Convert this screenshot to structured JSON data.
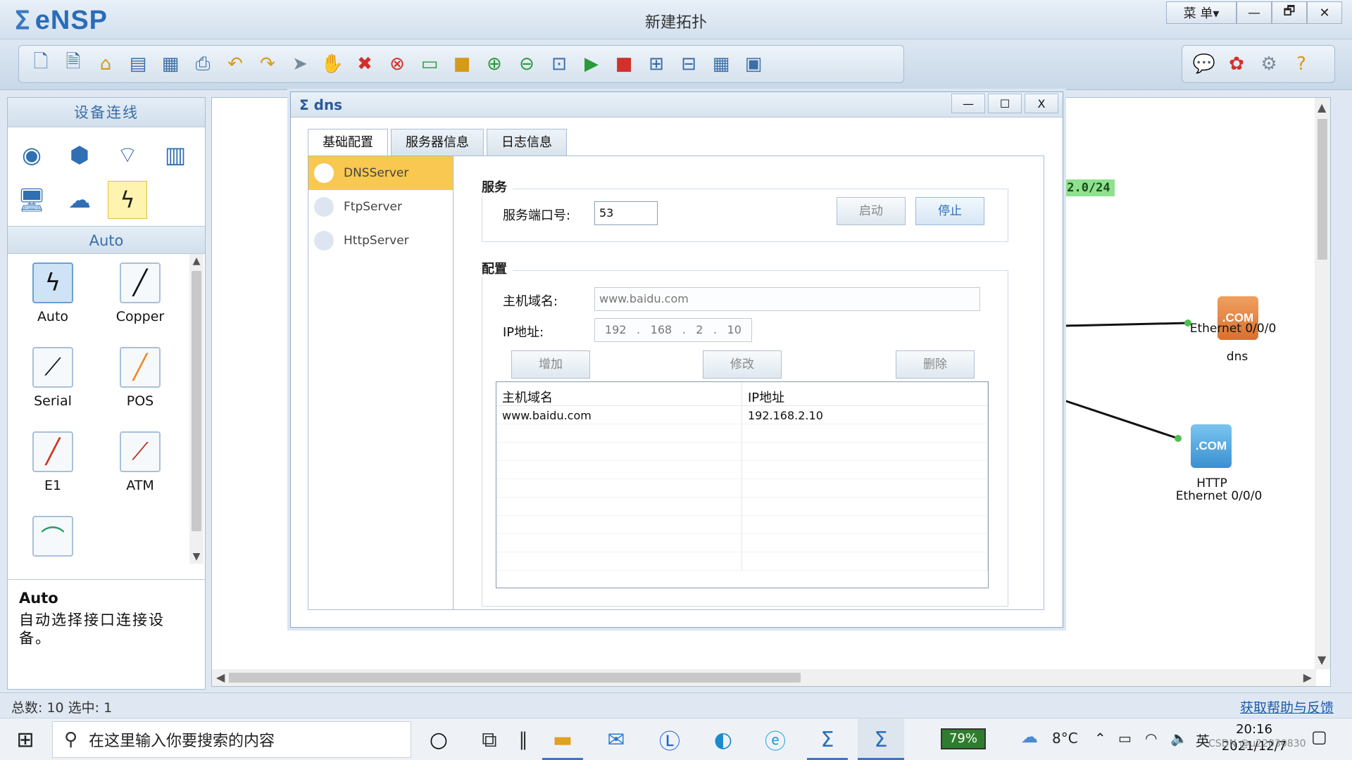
{
  "app": {
    "logo": "eNSP",
    "window_title": "新建拓扑",
    "menu_label": "菜 单▾",
    "min_glyph": "—",
    "restore_glyph": "🗗",
    "close_glyph": "✕"
  },
  "toolbar": {
    "icons": [
      "new-topology-icon",
      "new-example-icon",
      "open-icon",
      "save-icon",
      "save-as-icon",
      "print-icon",
      "undo-icon",
      "redo-icon",
      "select-icon",
      "pan-icon",
      "delete-icon",
      "delete-link-icon",
      "text-icon",
      "rectangle-icon",
      "zoom-in-icon",
      "zoom-out-icon",
      "fit-icon",
      "start-icon",
      "stop-icon",
      "capture-icon",
      "topology-icon",
      "grid-icon",
      "screenshot-icon"
    ],
    "right_icons": [
      "chat-icon",
      "huawei-icon",
      "settings-icon",
      "help-icon"
    ]
  },
  "left": {
    "header": "设备连线",
    "devices": [
      "router-icon",
      "switch-icon",
      "wireless-icon",
      "firewall-icon",
      "pc-icon",
      "cloud-icon",
      "auto-link-icon"
    ],
    "sub_header": "Auto",
    "cables": [
      {
        "label": "Auto",
        "icon": "lightning-icon"
      },
      {
        "label": "Copper",
        "icon": "copper-cable-icon"
      },
      {
        "label": "Serial",
        "icon": "serial-cable-icon"
      },
      {
        "label": "POS",
        "icon": "pos-cable-icon"
      },
      {
        "label": "E1",
        "icon": "e1-cable-icon"
      },
      {
        "label": "ATM",
        "icon": "atm-cable-icon"
      },
      {
        "label": "",
        "icon": "ctl-cable-icon"
      }
    ],
    "desc_title": "Auto",
    "desc_text": "自动选择接口连接设备。"
  },
  "canvas": {
    "subnet_label": ".2.0/24",
    "dns_port": "Ethernet 0/0/0",
    "dns_name": "dns",
    "http_name": "HTTP",
    "http_port": "Ethernet 0/0/0",
    "server_badge": ".COM"
  },
  "dialog": {
    "title": "dns",
    "tabs": [
      "基础配置",
      "服务器信息",
      "日志信息"
    ],
    "servers": [
      "DNSServer",
      "FtpServer",
      "HttpServer"
    ],
    "service_group": "服务",
    "port_label": "服务端口号:",
    "port_value": "53",
    "start_btn": "启动",
    "stop_btn": "停止",
    "config_group": "配置",
    "host_label": "主机域名:",
    "host_value": "www.baidu.com",
    "ip_label": "IP地址:",
    "ip_octets": [
      "192",
      "168",
      "2",
      "10"
    ],
    "add_btn": "增加",
    "modify_btn": "修改",
    "delete_btn": "删除",
    "table": {
      "headers": [
        "主机域名",
        "IP地址"
      ],
      "rows": [
        [
          "www.baidu.com",
          "192.168.2.10"
        ]
      ]
    }
  },
  "status": {
    "left": "总数: 10 选中: 1",
    "right": "获取帮助与反馈"
  },
  "taskbar": {
    "search_placeholder": "在这里输入你要搜索的内容",
    "battery": "79%",
    "temperature": "8°C",
    "ime": "英",
    "time": "20:16",
    "date": "2021/12/7",
    "watermark": "CSDN @u22030830"
  }
}
